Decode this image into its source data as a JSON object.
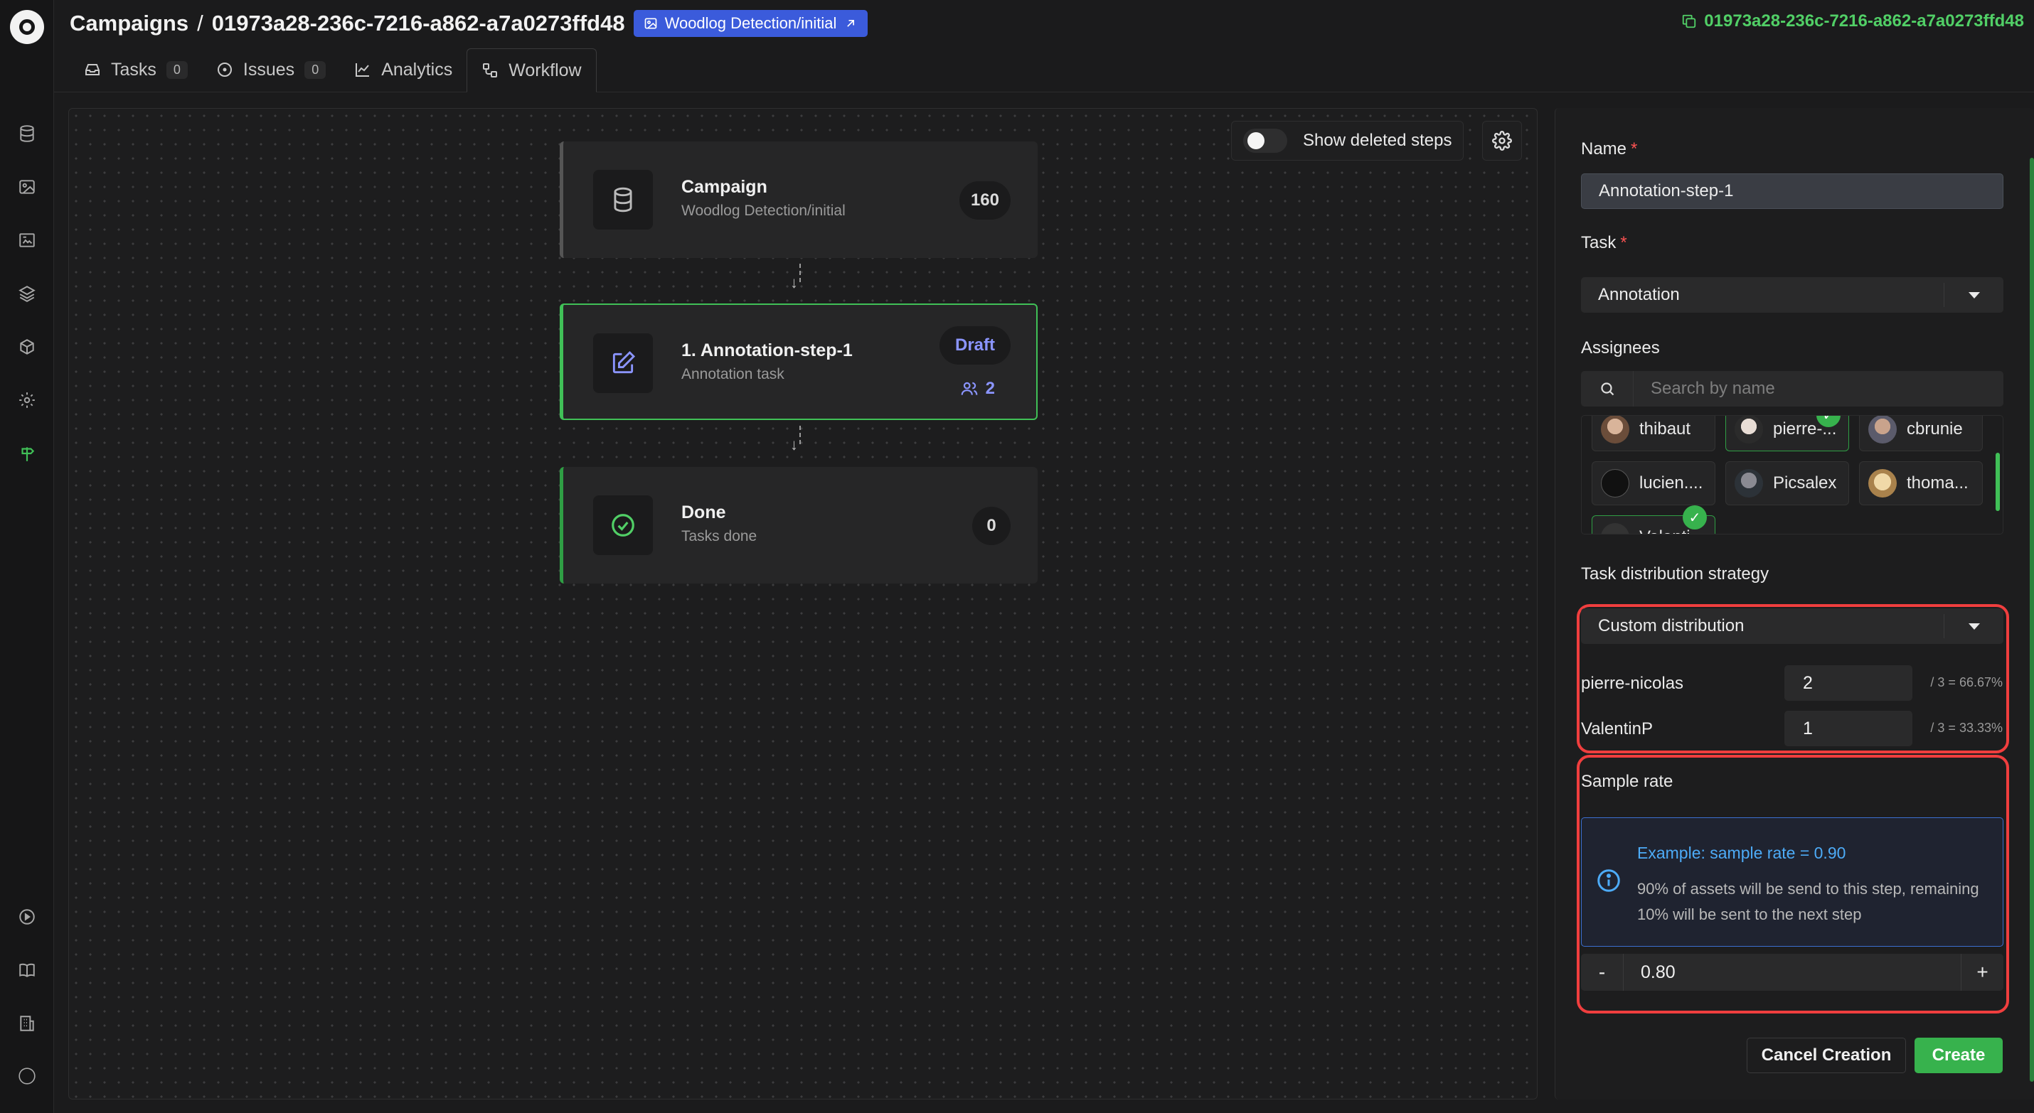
{
  "header": {
    "breadcrumb_root": "Campaigns",
    "breadcrumb_sep": "/",
    "campaign_id": "01973a28-236c-7216-a862-a7a0273ffd48",
    "dataset_badge": "Woodlog Detection/initial",
    "copy_id_label": "01973a28-236c-7216-a862-a7a0273ffd48"
  },
  "tabs": [
    {
      "label": "Tasks",
      "count": "0",
      "icon": "inbox-icon"
    },
    {
      "label": "Issues",
      "count": "0",
      "icon": "issue-icon"
    },
    {
      "label": "Analytics",
      "icon": "chart-line-icon"
    },
    {
      "label": "Workflow",
      "icon": "workflow-icon",
      "active": true
    }
  ],
  "canvas": {
    "show_deleted_label": "Show deleted steps",
    "show_deleted_on": false,
    "nodes": {
      "campaign": {
        "title": "Campaign",
        "subtitle": "Woodlog Detection/initial",
        "count": "160"
      },
      "annotation": {
        "title": "1. Annotation-step-1",
        "subtitle": "Annotation task",
        "status": "Draft",
        "assignee_count": "2"
      },
      "done": {
        "title": "Done",
        "subtitle": "Tasks done",
        "count": "0"
      }
    }
  },
  "form": {
    "name_label": "Name",
    "name_required": "*",
    "name_value": "Annotation-step-1",
    "task_label": "Task",
    "task_required": "*",
    "task_value": "Annotation",
    "assignees_label": "Assignees",
    "assignee_search_placeholder": "Search by name",
    "assignees": [
      {
        "name": "thibaut",
        "selected": false
      },
      {
        "name": "pierre-...",
        "selected": true
      },
      {
        "name": "cbrunie",
        "selected": false
      },
      {
        "name": "lucien....",
        "selected": false
      },
      {
        "name": "Picsalex",
        "selected": false
      },
      {
        "name": "thoma...",
        "selected": false
      },
      {
        "name": "Valenti...",
        "selected": true
      }
    ],
    "distribution_label": "Task distribution strategy",
    "distribution_value": "Custom distribution",
    "distribution_rows": [
      {
        "name": "pierre-nicolas",
        "value": "2",
        "share": "/ 3 = 66.67%"
      },
      {
        "name": "ValentinP",
        "value": "1",
        "share": "/ 3 = 33.33%"
      }
    ],
    "sample_rate_label": "Sample rate",
    "info_title": "Example: sample rate = 0.90",
    "info_text": "90% of assets will be send to this step, remaining 10% will be sent to the next step",
    "sample_rate_value": "0.80",
    "minus_label": "-",
    "plus_label": "+",
    "cancel_label": "Cancel Creation",
    "create_label": "Create"
  },
  "colors": {
    "accent_green": "#37b24d",
    "accent_blue": "#3b5bdb",
    "highlight_red": "#f03e3e",
    "draft_purple": "#8b95ff"
  }
}
